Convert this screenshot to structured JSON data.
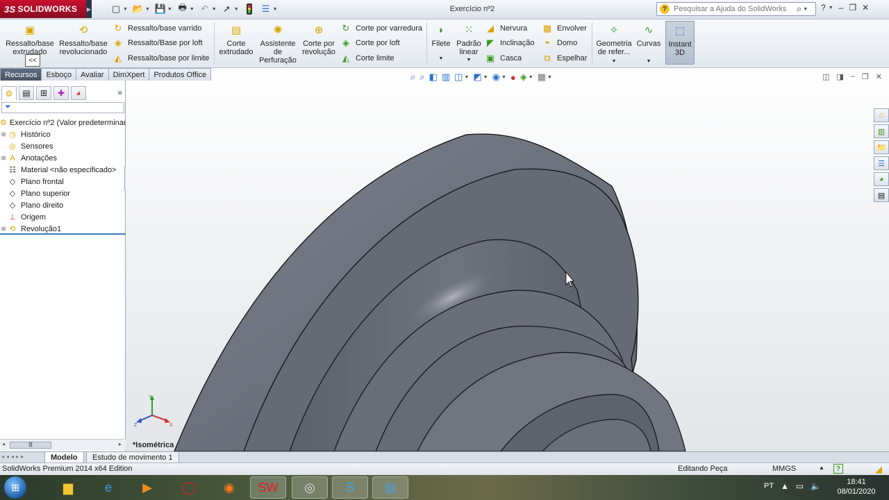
{
  "app": {
    "brand": "SOLIDWORKS",
    "brand_prefix": "3S",
    "doc_title": "Exercício nº2"
  },
  "search": {
    "placeholder": "Pesquisar a Ajuda do SolidWorks"
  },
  "ribbon": {
    "extruded_boss": "Ressalto/base extrudado",
    "revolved_boss": "Ressalto/base revolucionado",
    "swept_boss": "Ressalto/base varrido",
    "lofted_boss": "Ressalto/Base por loft",
    "boundary_boss": "Ressalto/base por limite",
    "extruded_cut": "Corte extrudado",
    "hole_wizard": "Assistente de Perfuração",
    "revolved_cut": "Corte por revolução",
    "swept_cut": "Corte por varredura",
    "lofted_cut": "Corte por loft",
    "boundary_cut": "Corte limite",
    "fillet": "Filete",
    "linear_pattern": "Padrão linear",
    "rib": "Nervura",
    "draft": "Inclinação",
    "shell": "Casca",
    "wrap": "Envolver",
    "dome": "Domo",
    "mirror": "Espelhar",
    "ref_geometry": "Geometria de refer...",
    "curves": "Curvas",
    "instant3d": "Instant 3D",
    "collapse": "<<"
  },
  "command_tabs": [
    "Recursos",
    "Esboço",
    "Avaliar",
    "DimXpert",
    "Produtos Office"
  ],
  "feature_tree": {
    "root": "Exercício nº2  (Valor predeterminado)",
    "items": [
      {
        "label": "Histórico",
        "icon": "history-icon",
        "expandable": true
      },
      {
        "label": "Sensores",
        "icon": "sensor-icon",
        "expandable": false
      },
      {
        "label": "Anotações",
        "icon": "annotation-icon",
        "expandable": true
      },
      {
        "label": "Material <não especificado>",
        "icon": "material-icon",
        "expandable": false
      },
      {
        "label": "Plano frontal",
        "icon": "plane-icon",
        "expandable": false
      },
      {
        "label": "Plano superior",
        "icon": "plane-icon",
        "expandable": false
      },
      {
        "label": "Plano direito",
        "icon": "plane-icon",
        "expandable": false
      },
      {
        "label": "Origem",
        "icon": "origin-icon",
        "expandable": false
      },
      {
        "label": "Revolução1",
        "icon": "revolve-icon",
        "expandable": true
      }
    ]
  },
  "viewport": {
    "view_label": "*Isométrica"
  },
  "bottom_tabs": {
    "model": "Modelo",
    "motion": "Estudo de movimento 1"
  },
  "status": {
    "edition": "SolidWorks Premium 2014 x64 Edition",
    "mode": "Editando Peça",
    "units": "MMGS"
  },
  "taskbar": {
    "lang": "PT",
    "time": "18:41",
    "date": "08/01/2020"
  },
  "colors": {
    "brand": "#c8102e",
    "model_gray": "#6d717d",
    "accent": "#2a6fcc"
  }
}
